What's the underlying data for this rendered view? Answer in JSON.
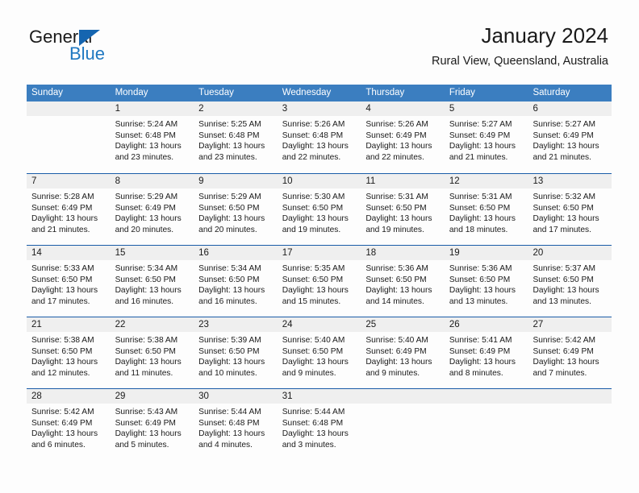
{
  "logo": {
    "word1": "General",
    "word2": "Blue",
    "triangle_color": "#1565b0",
    "blue_color": "#1f78c1"
  },
  "header": {
    "title": "January 2024",
    "subtitle": "Rural View, Queensland, Australia"
  },
  "theme": {
    "header_blue": "#3b7ec0",
    "row_line_blue": "#1a5ca8",
    "day_number_band": "#efefef",
    "page_background": "#fdfdfd",
    "text": "#1a1a1a"
  },
  "weekdays": [
    "Sunday",
    "Monday",
    "Tuesday",
    "Wednesday",
    "Thursday",
    "Friday",
    "Saturday"
  ],
  "labels": {
    "sunrise_prefix": "Sunrise:",
    "sunset_prefix": "Sunset:",
    "daylight_prefix": "Daylight:"
  },
  "weeks": [
    [
      {
        "day": "",
        "sunrise": "",
        "sunset": "",
        "daylight": "",
        "empty": true
      },
      {
        "day": "1",
        "sunrise": "Sunrise: 5:24 AM",
        "sunset": "Sunset: 6:48 PM",
        "daylight": "Daylight: 13 hours and 23 minutes."
      },
      {
        "day": "2",
        "sunrise": "Sunrise: 5:25 AM",
        "sunset": "Sunset: 6:48 PM",
        "daylight": "Daylight: 13 hours and 23 minutes."
      },
      {
        "day": "3",
        "sunrise": "Sunrise: 5:26 AM",
        "sunset": "Sunset: 6:48 PM",
        "daylight": "Daylight: 13 hours and 22 minutes."
      },
      {
        "day": "4",
        "sunrise": "Sunrise: 5:26 AM",
        "sunset": "Sunset: 6:49 PM",
        "daylight": "Daylight: 13 hours and 22 minutes."
      },
      {
        "day": "5",
        "sunrise": "Sunrise: 5:27 AM",
        "sunset": "Sunset: 6:49 PM",
        "daylight": "Daylight: 13 hours and 21 minutes."
      },
      {
        "day": "6",
        "sunrise": "Sunrise: 5:27 AM",
        "sunset": "Sunset: 6:49 PM",
        "daylight": "Daylight: 13 hours and 21 minutes."
      }
    ],
    [
      {
        "day": "7",
        "sunrise": "Sunrise: 5:28 AM",
        "sunset": "Sunset: 6:49 PM",
        "daylight": "Daylight: 13 hours and 21 minutes."
      },
      {
        "day": "8",
        "sunrise": "Sunrise: 5:29 AM",
        "sunset": "Sunset: 6:49 PM",
        "daylight": "Daylight: 13 hours and 20 minutes."
      },
      {
        "day": "9",
        "sunrise": "Sunrise: 5:29 AM",
        "sunset": "Sunset: 6:50 PM",
        "daylight": "Daylight: 13 hours and 20 minutes."
      },
      {
        "day": "10",
        "sunrise": "Sunrise: 5:30 AM",
        "sunset": "Sunset: 6:50 PM",
        "daylight": "Daylight: 13 hours and 19 minutes."
      },
      {
        "day": "11",
        "sunrise": "Sunrise: 5:31 AM",
        "sunset": "Sunset: 6:50 PM",
        "daylight": "Daylight: 13 hours and 19 minutes."
      },
      {
        "day": "12",
        "sunrise": "Sunrise: 5:31 AM",
        "sunset": "Sunset: 6:50 PM",
        "daylight": "Daylight: 13 hours and 18 minutes."
      },
      {
        "day": "13",
        "sunrise": "Sunrise: 5:32 AM",
        "sunset": "Sunset: 6:50 PM",
        "daylight": "Daylight: 13 hours and 17 minutes."
      }
    ],
    [
      {
        "day": "14",
        "sunrise": "Sunrise: 5:33 AM",
        "sunset": "Sunset: 6:50 PM",
        "daylight": "Daylight: 13 hours and 17 minutes."
      },
      {
        "day": "15",
        "sunrise": "Sunrise: 5:34 AM",
        "sunset": "Sunset: 6:50 PM",
        "daylight": "Daylight: 13 hours and 16 minutes."
      },
      {
        "day": "16",
        "sunrise": "Sunrise: 5:34 AM",
        "sunset": "Sunset: 6:50 PM",
        "daylight": "Daylight: 13 hours and 16 minutes."
      },
      {
        "day": "17",
        "sunrise": "Sunrise: 5:35 AM",
        "sunset": "Sunset: 6:50 PM",
        "daylight": "Daylight: 13 hours and 15 minutes."
      },
      {
        "day": "18",
        "sunrise": "Sunrise: 5:36 AM",
        "sunset": "Sunset: 6:50 PM",
        "daylight": "Daylight: 13 hours and 14 minutes."
      },
      {
        "day": "19",
        "sunrise": "Sunrise: 5:36 AM",
        "sunset": "Sunset: 6:50 PM",
        "daylight": "Daylight: 13 hours and 13 minutes."
      },
      {
        "day": "20",
        "sunrise": "Sunrise: 5:37 AM",
        "sunset": "Sunset: 6:50 PM",
        "daylight": "Daylight: 13 hours and 13 minutes."
      }
    ],
    [
      {
        "day": "21",
        "sunrise": "Sunrise: 5:38 AM",
        "sunset": "Sunset: 6:50 PM",
        "daylight": "Daylight: 13 hours and 12 minutes."
      },
      {
        "day": "22",
        "sunrise": "Sunrise: 5:38 AM",
        "sunset": "Sunset: 6:50 PM",
        "daylight": "Daylight: 13 hours and 11 minutes."
      },
      {
        "day": "23",
        "sunrise": "Sunrise: 5:39 AM",
        "sunset": "Sunset: 6:50 PM",
        "daylight": "Daylight: 13 hours and 10 minutes."
      },
      {
        "day": "24",
        "sunrise": "Sunrise: 5:40 AM",
        "sunset": "Sunset: 6:50 PM",
        "daylight": "Daylight: 13 hours and 9 minutes."
      },
      {
        "day": "25",
        "sunrise": "Sunrise: 5:40 AM",
        "sunset": "Sunset: 6:49 PM",
        "daylight": "Daylight: 13 hours and 9 minutes."
      },
      {
        "day": "26",
        "sunrise": "Sunrise: 5:41 AM",
        "sunset": "Sunset: 6:49 PM",
        "daylight": "Daylight: 13 hours and 8 minutes."
      },
      {
        "day": "27",
        "sunrise": "Sunrise: 5:42 AM",
        "sunset": "Sunset: 6:49 PM",
        "daylight": "Daylight: 13 hours and 7 minutes."
      }
    ],
    [
      {
        "day": "28",
        "sunrise": "Sunrise: 5:42 AM",
        "sunset": "Sunset: 6:49 PM",
        "daylight": "Daylight: 13 hours and 6 minutes."
      },
      {
        "day": "29",
        "sunrise": "Sunrise: 5:43 AM",
        "sunset": "Sunset: 6:49 PM",
        "daylight": "Daylight: 13 hours and 5 minutes."
      },
      {
        "day": "30",
        "sunrise": "Sunrise: 5:44 AM",
        "sunset": "Sunset: 6:48 PM",
        "daylight": "Daylight: 13 hours and 4 minutes."
      },
      {
        "day": "31",
        "sunrise": "Sunrise: 5:44 AM",
        "sunset": "Sunset: 6:48 PM",
        "daylight": "Daylight: 13 hours and 3 minutes."
      },
      {
        "day": "",
        "sunrise": "",
        "sunset": "",
        "daylight": "",
        "empty": true
      },
      {
        "day": "",
        "sunrise": "",
        "sunset": "",
        "daylight": "",
        "empty": true
      },
      {
        "day": "",
        "sunrise": "",
        "sunset": "",
        "daylight": "",
        "empty": true
      }
    ]
  ]
}
